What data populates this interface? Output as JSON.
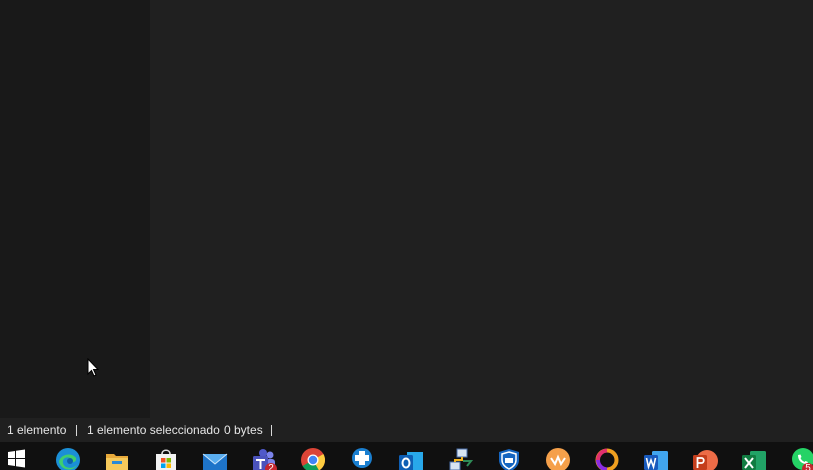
{
  "statusbar": {
    "item_count": "1 elemento",
    "selected": "1 elemento seleccionado",
    "size": "0 bytes"
  },
  "taskbar": {
    "apps": [
      {
        "name": "start",
        "icon": "windows-icon"
      },
      {
        "name": "edge",
        "icon": "edge-icon"
      },
      {
        "name": "file-explorer",
        "icon": "folder-icon"
      },
      {
        "name": "microsoft-store",
        "icon": "store-icon"
      },
      {
        "name": "mail",
        "icon": "mail-icon"
      },
      {
        "name": "teams",
        "icon": "teams-icon",
        "badge": "2"
      },
      {
        "name": "chrome",
        "icon": "chrome-icon"
      },
      {
        "name": "health-app",
        "icon": "medical-cross-icon"
      },
      {
        "name": "outlook",
        "icon": "outlook-icon"
      },
      {
        "name": "network-app",
        "icon": "network-icon"
      },
      {
        "name": "security-app",
        "icon": "shield-icon"
      },
      {
        "name": "orange-app",
        "icon": "orange-app-icon"
      },
      {
        "name": "ring-app",
        "icon": "ring-icon"
      },
      {
        "name": "word",
        "icon": "word-icon"
      },
      {
        "name": "powerpoint",
        "icon": "powerpoint-icon"
      },
      {
        "name": "excel",
        "icon": "excel-icon"
      },
      {
        "name": "whatsapp",
        "icon": "whatsapp-icon",
        "badge": "5"
      }
    ]
  },
  "colors": {
    "nav_bg": "#191919",
    "content_bg": "#202020",
    "taskbar_bg": "#101010",
    "status_text": "#e6e6e6",
    "badge": "#c4262e"
  }
}
